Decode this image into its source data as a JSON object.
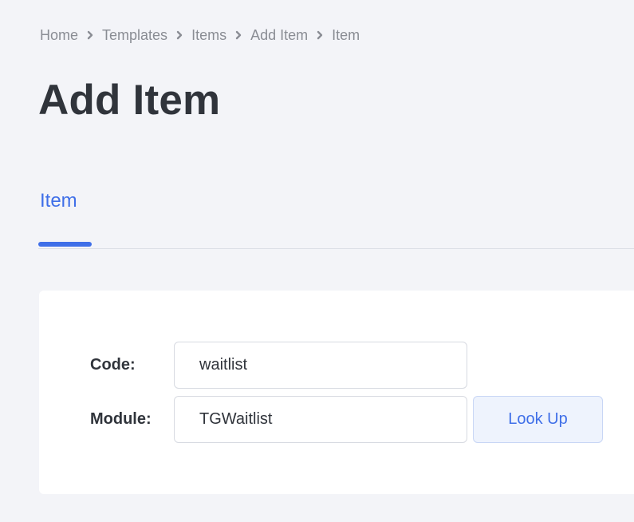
{
  "breadcrumb": {
    "items": [
      "Home",
      "Templates",
      "Items",
      "Add Item",
      "Item"
    ],
    "separator_icon": "chevron-right-icon"
  },
  "page": {
    "title": "Add Item"
  },
  "tabs": [
    {
      "label": "Item",
      "active": true
    }
  ],
  "colors": {
    "accent": "#3f6fe8",
    "background": "#f3f4f8",
    "card": "#ffffff"
  },
  "form": {
    "code": {
      "label": "Code:",
      "value": "waitlist"
    },
    "module": {
      "label": "Module:",
      "value": "TGWaitlist"
    },
    "lookup_button": "Look Up"
  }
}
